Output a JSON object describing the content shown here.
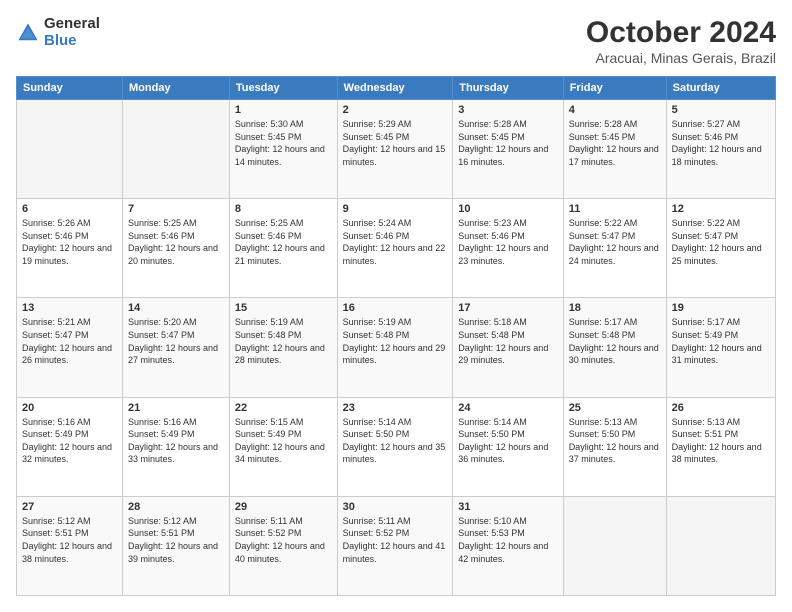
{
  "logo": {
    "general": "General",
    "blue": "Blue"
  },
  "header": {
    "month": "October 2024",
    "location": "Aracuai, Minas Gerais, Brazil"
  },
  "weekdays": [
    "Sunday",
    "Monday",
    "Tuesday",
    "Wednesday",
    "Thursday",
    "Friday",
    "Saturday"
  ],
  "weeks": [
    [
      {
        "day": "",
        "sunrise": "",
        "sunset": "",
        "daylight": "",
        "empty": true
      },
      {
        "day": "",
        "sunrise": "",
        "sunset": "",
        "daylight": "",
        "empty": true
      },
      {
        "day": "1",
        "sunrise": "Sunrise: 5:30 AM",
        "sunset": "Sunset: 5:45 PM",
        "daylight": "Daylight: 12 hours and 14 minutes."
      },
      {
        "day": "2",
        "sunrise": "Sunrise: 5:29 AM",
        "sunset": "Sunset: 5:45 PM",
        "daylight": "Daylight: 12 hours and 15 minutes."
      },
      {
        "day": "3",
        "sunrise": "Sunrise: 5:28 AM",
        "sunset": "Sunset: 5:45 PM",
        "daylight": "Daylight: 12 hours and 16 minutes."
      },
      {
        "day": "4",
        "sunrise": "Sunrise: 5:28 AM",
        "sunset": "Sunset: 5:45 PM",
        "daylight": "Daylight: 12 hours and 17 minutes."
      },
      {
        "day": "5",
        "sunrise": "Sunrise: 5:27 AM",
        "sunset": "Sunset: 5:46 PM",
        "daylight": "Daylight: 12 hours and 18 minutes."
      }
    ],
    [
      {
        "day": "6",
        "sunrise": "Sunrise: 5:26 AM",
        "sunset": "Sunset: 5:46 PM",
        "daylight": "Daylight: 12 hours and 19 minutes."
      },
      {
        "day": "7",
        "sunrise": "Sunrise: 5:25 AM",
        "sunset": "Sunset: 5:46 PM",
        "daylight": "Daylight: 12 hours and 20 minutes."
      },
      {
        "day": "8",
        "sunrise": "Sunrise: 5:25 AM",
        "sunset": "Sunset: 5:46 PM",
        "daylight": "Daylight: 12 hours and 21 minutes."
      },
      {
        "day": "9",
        "sunrise": "Sunrise: 5:24 AM",
        "sunset": "Sunset: 5:46 PM",
        "daylight": "Daylight: 12 hours and 22 minutes."
      },
      {
        "day": "10",
        "sunrise": "Sunrise: 5:23 AM",
        "sunset": "Sunset: 5:46 PM",
        "daylight": "Daylight: 12 hours and 23 minutes."
      },
      {
        "day": "11",
        "sunrise": "Sunrise: 5:22 AM",
        "sunset": "Sunset: 5:47 PM",
        "daylight": "Daylight: 12 hours and 24 minutes."
      },
      {
        "day": "12",
        "sunrise": "Sunrise: 5:22 AM",
        "sunset": "Sunset: 5:47 PM",
        "daylight": "Daylight: 12 hours and 25 minutes."
      }
    ],
    [
      {
        "day": "13",
        "sunrise": "Sunrise: 5:21 AM",
        "sunset": "Sunset: 5:47 PM",
        "daylight": "Daylight: 12 hours and 26 minutes."
      },
      {
        "day": "14",
        "sunrise": "Sunrise: 5:20 AM",
        "sunset": "Sunset: 5:47 PM",
        "daylight": "Daylight: 12 hours and 27 minutes."
      },
      {
        "day": "15",
        "sunrise": "Sunrise: 5:19 AM",
        "sunset": "Sunset: 5:48 PM",
        "daylight": "Daylight: 12 hours and 28 minutes."
      },
      {
        "day": "16",
        "sunrise": "Sunrise: 5:19 AM",
        "sunset": "Sunset: 5:48 PM",
        "daylight": "Daylight: 12 hours and 29 minutes."
      },
      {
        "day": "17",
        "sunrise": "Sunrise: 5:18 AM",
        "sunset": "Sunset: 5:48 PM",
        "daylight": "Daylight: 12 hours and 29 minutes."
      },
      {
        "day": "18",
        "sunrise": "Sunrise: 5:17 AM",
        "sunset": "Sunset: 5:48 PM",
        "daylight": "Daylight: 12 hours and 30 minutes."
      },
      {
        "day": "19",
        "sunrise": "Sunrise: 5:17 AM",
        "sunset": "Sunset: 5:49 PM",
        "daylight": "Daylight: 12 hours and 31 minutes."
      }
    ],
    [
      {
        "day": "20",
        "sunrise": "Sunrise: 5:16 AM",
        "sunset": "Sunset: 5:49 PM",
        "daylight": "Daylight: 12 hours and 32 minutes."
      },
      {
        "day": "21",
        "sunrise": "Sunrise: 5:16 AM",
        "sunset": "Sunset: 5:49 PM",
        "daylight": "Daylight: 12 hours and 33 minutes."
      },
      {
        "day": "22",
        "sunrise": "Sunrise: 5:15 AM",
        "sunset": "Sunset: 5:49 PM",
        "daylight": "Daylight: 12 hours and 34 minutes."
      },
      {
        "day": "23",
        "sunrise": "Sunrise: 5:14 AM",
        "sunset": "Sunset: 5:50 PM",
        "daylight": "Daylight: 12 hours and 35 minutes."
      },
      {
        "day": "24",
        "sunrise": "Sunrise: 5:14 AM",
        "sunset": "Sunset: 5:50 PM",
        "daylight": "Daylight: 12 hours and 36 minutes."
      },
      {
        "day": "25",
        "sunrise": "Sunrise: 5:13 AM",
        "sunset": "Sunset: 5:50 PM",
        "daylight": "Daylight: 12 hours and 37 minutes."
      },
      {
        "day": "26",
        "sunrise": "Sunrise: 5:13 AM",
        "sunset": "Sunset: 5:51 PM",
        "daylight": "Daylight: 12 hours and 38 minutes."
      }
    ],
    [
      {
        "day": "27",
        "sunrise": "Sunrise: 5:12 AM",
        "sunset": "Sunset: 5:51 PM",
        "daylight": "Daylight: 12 hours and 38 minutes."
      },
      {
        "day": "28",
        "sunrise": "Sunrise: 5:12 AM",
        "sunset": "Sunset: 5:51 PM",
        "daylight": "Daylight: 12 hours and 39 minutes."
      },
      {
        "day": "29",
        "sunrise": "Sunrise: 5:11 AM",
        "sunset": "Sunset: 5:52 PM",
        "daylight": "Daylight: 12 hours and 40 minutes."
      },
      {
        "day": "30",
        "sunrise": "Sunrise: 5:11 AM",
        "sunset": "Sunset: 5:52 PM",
        "daylight": "Daylight: 12 hours and 41 minutes."
      },
      {
        "day": "31",
        "sunrise": "Sunrise: 5:10 AM",
        "sunset": "Sunset: 5:53 PM",
        "daylight": "Daylight: 12 hours and 42 minutes."
      },
      {
        "day": "",
        "sunrise": "",
        "sunset": "",
        "daylight": "",
        "empty": true
      },
      {
        "day": "",
        "sunrise": "",
        "sunset": "",
        "daylight": "",
        "empty": true
      }
    ]
  ]
}
